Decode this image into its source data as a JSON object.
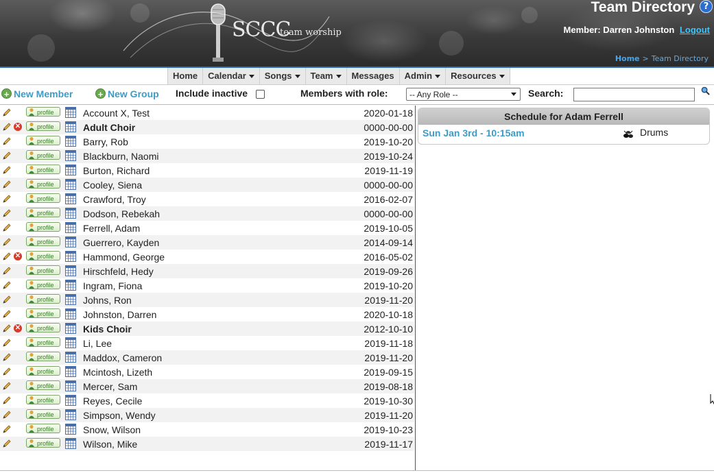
{
  "header": {
    "logo_main": "SCCC",
    "logo_sub": "team worship",
    "page_title": "Team Directory",
    "help_icon": "?",
    "member_label": "Member: Darren Johnston",
    "logout": "Logout",
    "breadcrumb": {
      "home": "Home",
      "separator": ">",
      "current": "Team Directory"
    }
  },
  "menu": [
    {
      "label": "Home",
      "dropdown": false
    },
    {
      "label": "Calendar",
      "dropdown": true
    },
    {
      "label": "Songs",
      "dropdown": true
    },
    {
      "label": "Team",
      "dropdown": true
    },
    {
      "label": "Messages",
      "dropdown": false
    },
    {
      "label": "Admin",
      "dropdown": true
    },
    {
      "label": "Resources",
      "dropdown": true
    }
  ],
  "toolbar": {
    "new_member": "New Member",
    "new_group": "New Group",
    "include_inactive": "Include inactive",
    "include_inactive_checked": false,
    "role_label": "Members with role:",
    "role_selected": "-- Any Role --",
    "search_label": "Search:",
    "search_value": ""
  },
  "members": [
    {
      "name": "Account X, Test",
      "date": "2020-01-18",
      "group": false
    },
    {
      "name": "Adult Choir",
      "date": "0000-00-00",
      "group": true
    },
    {
      "name": "Barry, Rob",
      "date": "2019-10-20",
      "group": false
    },
    {
      "name": "Blackburn, Naomi",
      "date": "2019-10-24",
      "group": false
    },
    {
      "name": "Burton, Richard",
      "date": "2019-11-19",
      "group": false
    },
    {
      "name": "Cooley, Siena",
      "date": "0000-00-00",
      "group": false
    },
    {
      "name": "Crawford, Troy",
      "date": "2016-02-07",
      "group": false
    },
    {
      "name": "Dodson, Rebekah",
      "date": "0000-00-00",
      "group": false
    },
    {
      "name": "Ferrell, Adam",
      "date": "2019-10-05",
      "group": false
    },
    {
      "name": "Guerrero, Kayden",
      "date": "2014-09-14",
      "group": false
    },
    {
      "name": "Hammond, George",
      "date": "2016-05-02",
      "group": false,
      "deletable": true
    },
    {
      "name": "Hirschfeld, Hedy",
      "date": "2019-09-26",
      "group": false
    },
    {
      "name": "Ingram, Fiona",
      "date": "2019-10-20",
      "group": false
    },
    {
      "name": "Johns, Ron",
      "date": "2019-11-20",
      "group": false
    },
    {
      "name": "Johnston, Darren",
      "date": "2020-10-18",
      "group": false
    },
    {
      "name": "Kids Choir",
      "date": "2012-10-10",
      "group": true
    },
    {
      "name": "Li, Lee",
      "date": "2019-11-18",
      "group": false
    },
    {
      "name": "Maddox, Cameron",
      "date": "2019-11-20",
      "group": false
    },
    {
      "name": "Mcintosh, Lizeth",
      "date": "2019-09-15",
      "group": false
    },
    {
      "name": "Mercer, Sam",
      "date": "2019-08-18",
      "group": false
    },
    {
      "name": "Reyes, Cecile",
      "date": "2019-10-30",
      "group": false
    },
    {
      "name": "Simpson, Wendy",
      "date": "2019-11-20",
      "group": false
    },
    {
      "name": "Snow, Wilson",
      "date": "2019-10-23",
      "group": false
    },
    {
      "name": "Wilson, Mike",
      "date": "2019-11-17",
      "group": false
    }
  ],
  "profile_label": "profile",
  "schedule": {
    "title": "Schedule for Adam Ferrell",
    "entries": [
      {
        "date": "Sun Jan 3rd - 10:15am",
        "role": "Drums",
        "icon": "drums-icon"
      }
    ]
  },
  "colors": {
    "accent": "#3d9bc7",
    "nav_rule": "#2d6fb6",
    "row_alt": "#f2f2f2"
  }
}
